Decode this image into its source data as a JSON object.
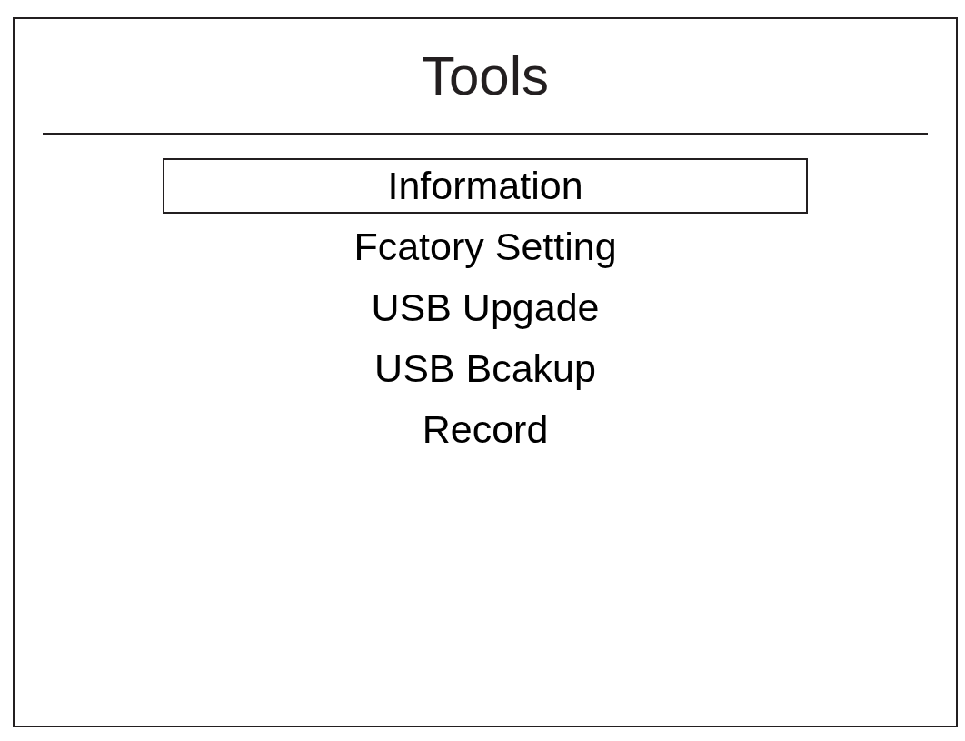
{
  "title": "Tools",
  "menu": [
    {
      "label": "Information",
      "selected": true
    },
    {
      "label": "Fcatory Setting",
      "selected": false
    },
    {
      "label": "USB Upgade",
      "selected": false
    },
    {
      "label": "USB Bcakup",
      "selected": false
    },
    {
      "label": "Record",
      "selected": false
    }
  ]
}
